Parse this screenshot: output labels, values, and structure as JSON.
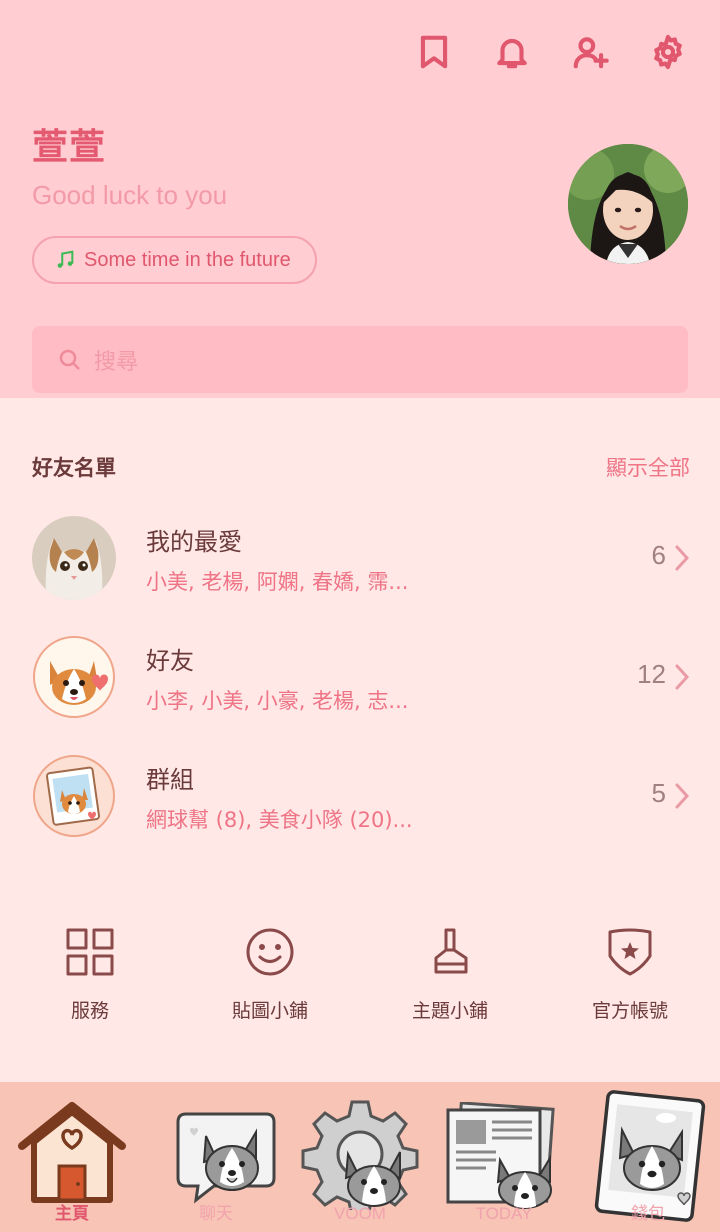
{
  "header": {
    "icons": [
      "bookmark-icon",
      "bell-icon",
      "add-friend-icon",
      "gear-icon"
    ],
    "user_name": "萱萱",
    "status_message": "Good luck to you",
    "music": "Some time in the future"
  },
  "search": {
    "placeholder": "搜尋"
  },
  "friends": {
    "title": "好友名單",
    "show_all": "顯示全部",
    "rows": [
      {
        "title": "我的最愛",
        "subtitle": "小美, 老楊, 阿嫻, 春嬌, 霈...",
        "count": "6"
      },
      {
        "title": "好友",
        "subtitle": "小李, 小美, 小豪, 老楊, 志...",
        "count": "12"
      },
      {
        "title": "群組",
        "subtitle": "網球幫 (8), 美食小隊 (20)...",
        "count": "5"
      }
    ]
  },
  "services": [
    {
      "label": "服務",
      "icon": "grid-icon"
    },
    {
      "label": "貼圖小鋪",
      "icon": "smiley-icon"
    },
    {
      "label": "主題小鋪",
      "icon": "brush-icon"
    },
    {
      "label": "官方帳號",
      "icon": "shield-star-icon"
    }
  ],
  "tabs": [
    {
      "label": "主頁",
      "icon": "house-icon",
      "active": true
    },
    {
      "label": "聊天",
      "icon": "chat-bubble-corgi-icon"
    },
    {
      "label": "VOOM",
      "icon": "gear-corgi-icon"
    },
    {
      "label": "TODAY",
      "icon": "newspaper-corgi-icon"
    },
    {
      "label": "錢包",
      "icon": "photo-card-corgi-icon"
    }
  ],
  "colors": {
    "header_bg": "#ffcdd2",
    "body_bg": "#ffe8e6",
    "accent": "#e0576e",
    "tabbar_bg": "#f7c4b5"
  }
}
